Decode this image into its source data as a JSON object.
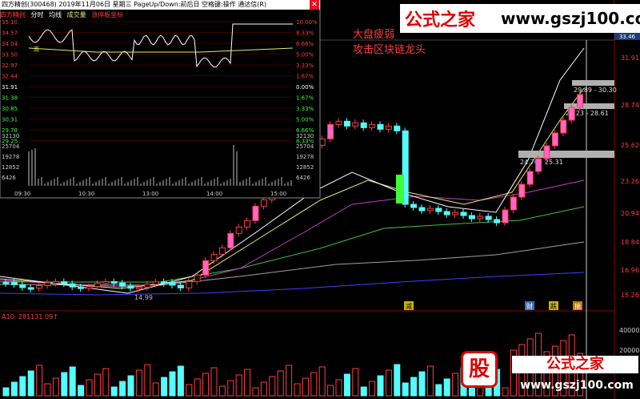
{
  "window": {
    "title": "四方精创(300468) 2019年11月06日 星期三 PageUp/Down:前后日 空格键:操作 通达信(R)",
    "close_glyph": "✕"
  },
  "popup": {
    "stock_name": "四方精创",
    "tabs": [
      "分时",
      "均线",
      "成交量",
      "涨停板坐标"
    ],
    "left_price_ticks": [
      "35.10",
      "34.57",
      "34.04",
      "33.50",
      "32.97",
      "32.44",
      "31.91",
      "31.38",
      "30.85",
      "30.31",
      "29.78",
      "29.25"
    ],
    "right_pct_ticks": [
      "10.00%",
      "8.33%",
      "6.66%",
      "5.00%",
      "3.33%",
      "1.67%",
      "0.00%",
      "1.67%",
      "3.33%",
      "5.00%",
      "6.66%",
      "8.33%"
    ],
    "volume_ticks": [
      "32130",
      "25704",
      "19278",
      "12852",
      "6426"
    ],
    "time_ticks": [
      "09:30",
      "10:30",
      "13:00",
      "14:00",
      "15:00"
    ],
    "high_label": "高"
  },
  "banner": {
    "cn": "公式之家",
    "url": "www.gszj100.com"
  },
  "annotations": {
    "line1": "大盘疲弱",
    "line2": "攻击区块链龙头",
    "zone_labels": [
      "29.89 - 30.30",
      "28.23 - 28.61",
      "24.70 - 25.31"
    ],
    "low_label": "14.99",
    "markers": [
      "减",
      "财",
      "跌",
      "揣"
    ]
  },
  "main_axis": {
    "price_ticks": [
      "31.91",
      "28.74",
      "25.62",
      "23.26",
      "20.94",
      "18.84",
      "16.96",
      "15.26"
    ],
    "top_box": "33.46"
  },
  "volume_panel": {
    "indicator": "A10: 281131.09↑",
    "ticks": [
      "40000",
      "20000"
    ]
  },
  "watermark": {
    "glyph": "股",
    "cn": "公式之家",
    "url": "www.gszj100.com"
  },
  "colors": {
    "up": "#ff3c3c",
    "up_fill": "#ff66cc",
    "down": "#54fcfc",
    "ma_white": "#ffffff",
    "ma_yellow": "#e8e870",
    "ma_magenta": "#c040c0",
    "ma_green": "#40c040",
    "ma_grey": "#a0a0a0",
    "ma_blue": "#4040ff",
    "annotation": "#ff3c3c",
    "support_box": "#b0b0b0"
  }
}
